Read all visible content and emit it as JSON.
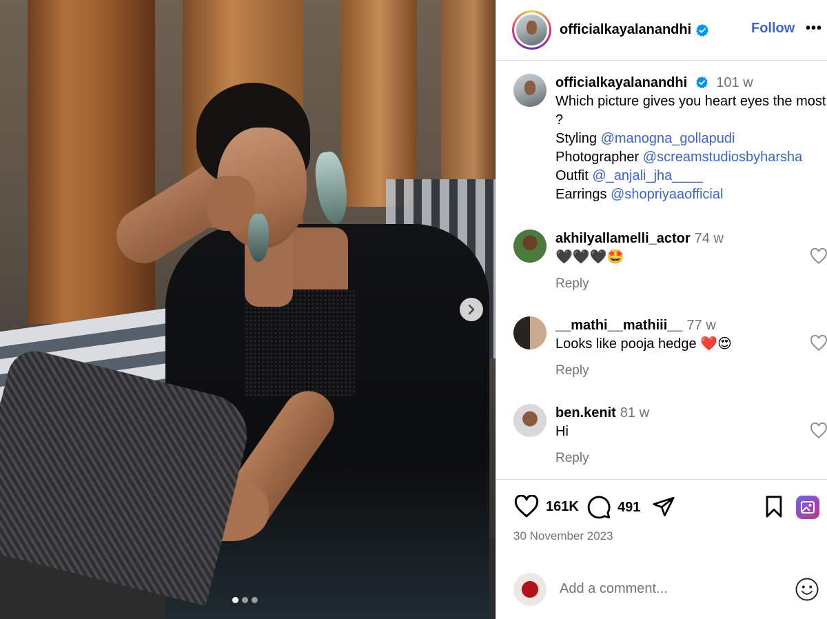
{
  "post": {
    "carousel": {
      "slide_count": 3,
      "active_slide": 1
    }
  },
  "header": {
    "username": "officialkayalanandhi",
    "follow_label": "Follow",
    "more_label": "•••"
  },
  "caption": {
    "username": "officialkayalanandhi",
    "time": "101 w",
    "text_line1": "Which picture gives you heart eyes the most ?",
    "credits": [
      {
        "role": "Styling",
        "handle": "@manogna_gollapudi"
      },
      {
        "role": "Photographer",
        "handle": "@screamstudiosbyharsha"
      },
      {
        "role": "Outfit",
        "handle": "@_anjali_jha____"
      },
      {
        "role": "Earrings",
        "handle": "@shopriyaaofficial"
      }
    ]
  },
  "comments": [
    {
      "username": "akhilyallamelli_actor",
      "time": "74 w",
      "text": "🖤🖤🖤🤩",
      "reply_label": "Reply"
    },
    {
      "username": "__mathi__mathiii__",
      "time": "77 w",
      "text": "Looks like pooja hedge ❤️😍",
      "reply_label": "Reply"
    },
    {
      "username": "ben.kenit",
      "time": "81 w",
      "text": "Hi",
      "reply_label": "Reply"
    }
  ],
  "actions": {
    "likes": "161K",
    "comments": "491",
    "date": "30 November 2023"
  },
  "add_comment": {
    "placeholder": "Add a comment..."
  },
  "colors": {
    "link": "#3a64d8",
    "verified": "#0095f6",
    "muted": "#737373",
    "divider": "#dbdbdb"
  },
  "icons": [
    "chevron-right-icon",
    "verified-icon",
    "more-icon",
    "heart-icon",
    "comment-icon",
    "share-icon",
    "bookmark-icon",
    "image-icon",
    "emoji-icon"
  ]
}
